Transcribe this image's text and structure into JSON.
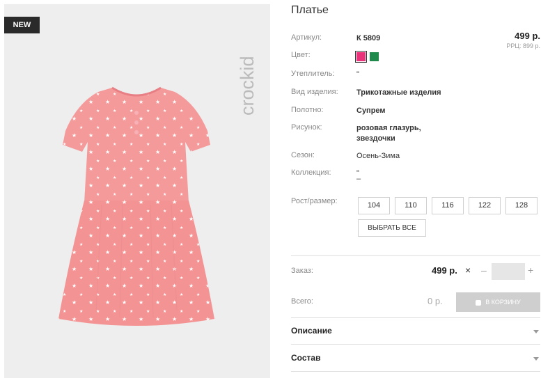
{
  "image": {
    "badge": "NEW",
    "brand": "crockid"
  },
  "product": {
    "title": "Платье",
    "price": "499 р.",
    "rrp": "РРЦ: 899 р."
  },
  "attributes": {
    "article": {
      "label": "Артикул:",
      "value": "К 5809"
    },
    "color": {
      "label": "Цвет:",
      "swatches": [
        "#e8337a",
        "#1f8a4c"
      ]
    },
    "insulation": {
      "label": "Утеплитель:",
      "value": "\""
    },
    "item_type": {
      "label": "Вид изделия:",
      "value": "Трикотажные изделия"
    },
    "fabric": {
      "label": "Полотно:",
      "value": "Супрем"
    },
    "pattern": {
      "label": "Рисунок:",
      "line1": "розовая глазурь,",
      "line2": "звездочки"
    },
    "season": {
      "label": "Сезон:",
      "value": "Осень-Зима"
    },
    "collection": {
      "label": "Коллекция:",
      "line1": "\"",
      "line2": "–"
    },
    "size": {
      "label": "Рост/размер:",
      "options": [
        "104",
        "110",
        "116",
        "122",
        "128"
      ],
      "select_all": "ВЫБРАТЬ ВСЕ"
    }
  },
  "order": {
    "label": "Заказ:",
    "price": "499 р.",
    "times": "×",
    "minus": "–",
    "plus": "+",
    "quantity": ""
  },
  "total": {
    "label": "Всего:",
    "value": "0 р.",
    "cart_button": "В КОРЗИНУ"
  },
  "accordion": [
    {
      "title": "Описание"
    },
    {
      "title": "Состав"
    }
  ],
  "colors": {
    "dress": "#f59a9a",
    "photo_bg": "#eeeeee",
    "brand_text": "#bbbbbb"
  }
}
